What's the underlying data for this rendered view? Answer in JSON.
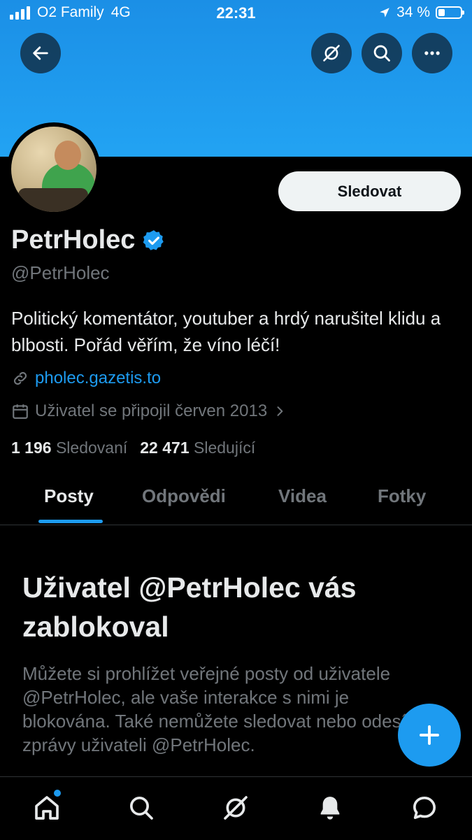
{
  "status_bar": {
    "carrier": "O2 Family",
    "network": "4G",
    "time": "22:31",
    "battery": "34 %",
    "battery_level": 0.34
  },
  "header": {
    "back_icon": "arrow-left-icon",
    "grok_icon": "grok-icon",
    "search_icon": "search-icon",
    "more_icon": "more-icon"
  },
  "profile": {
    "follow_label": "Sledovat",
    "name": "PetrHolec",
    "verified": true,
    "handle": "@PetrHolec",
    "bio": "Politický komentátor, youtuber a hrdý narušitel klidu a blbosti. Pořád věřím, že víno léčí!",
    "link": "pholec.gazetis.to",
    "joined": "Uživatel se připojil červen 2013",
    "following_count": "1 196",
    "following_label": "Sledovaní",
    "followers_count": "22 471",
    "followers_label": "Sledující"
  },
  "tabs": [
    "Posty",
    "Odpovědi",
    "Videa",
    "Fotky"
  ],
  "active_tab": "Posty",
  "blocked": {
    "title": "Uživatel @PetrHolec vás zablokoval",
    "description": "Můžete si prohlížet veřejné posty od uživatele @PetrHolec, ale vaše interakce s nimi je blokována. Také nemůžete sledovat nebo odesílat zprávy uživateli @PetrHolec."
  },
  "bottom_nav": [
    "home-icon",
    "search-icon",
    "grok-icon",
    "notifications-icon",
    "messages-icon"
  ],
  "colors": {
    "accent": "#1d9bf0",
    "background": "#000000",
    "banner": "#1da1f2",
    "secondary_text": "#71767b"
  }
}
